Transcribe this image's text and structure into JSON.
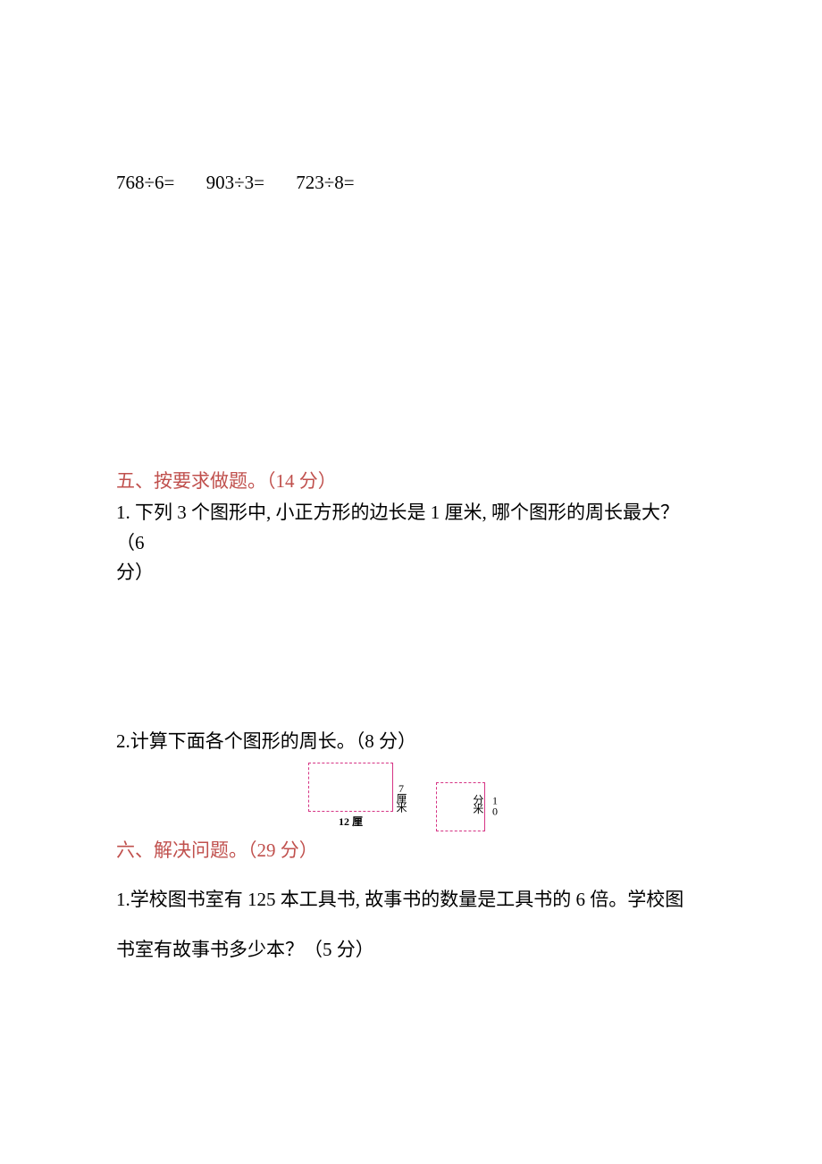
{
  "equations": {
    "eq1": "768÷6=",
    "eq2": "903÷3=",
    "eq3": "723÷8="
  },
  "section5": {
    "header": "五、按要求做题。（14 分）",
    "q1_line1": "1. 下列 3 个图形中, 小正方形的边长是 1 厘米, 哪个图形的周长最大？（6",
    "q1_line2": "分）",
    "q2": "2.计算下面各个图形的周长。（8 分）",
    "rect_right_label": "7厘米",
    "rect_bottom_label": "12 厘",
    "square_right_label": "10分米"
  },
  "section6": {
    "header": "六、解决问题。（29 分）",
    "q1_line1": "1.学校图书室有 125 本工具书, 故事书的数量是工具书的 6 倍。学校图",
    "q1_line2": "书室有故事书多少本？（5 分）"
  }
}
